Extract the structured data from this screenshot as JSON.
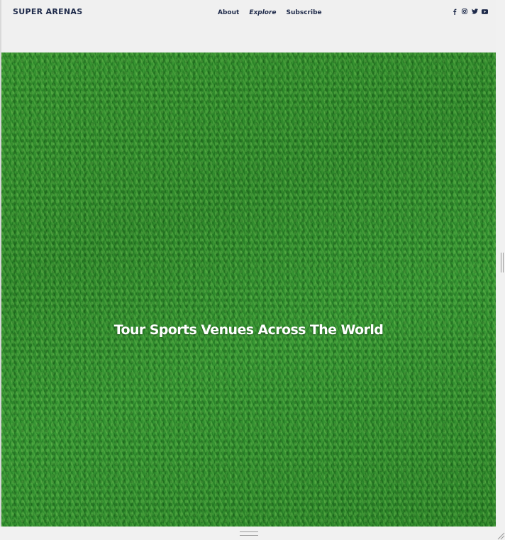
{
  "header": {
    "brand": "SUPER ARENAS",
    "nav": [
      {
        "label": "About"
      },
      {
        "label": "Explore"
      },
      {
        "label": "Subscribe"
      }
    ],
    "social_icons": [
      "facebook-icon",
      "instagram-icon",
      "twitter-icon",
      "youtube-icon"
    ],
    "text_color": "#1e2a4a"
  },
  "hero": {
    "title": "Tour Sports Venues Across The World",
    "background": "green grass texture"
  }
}
